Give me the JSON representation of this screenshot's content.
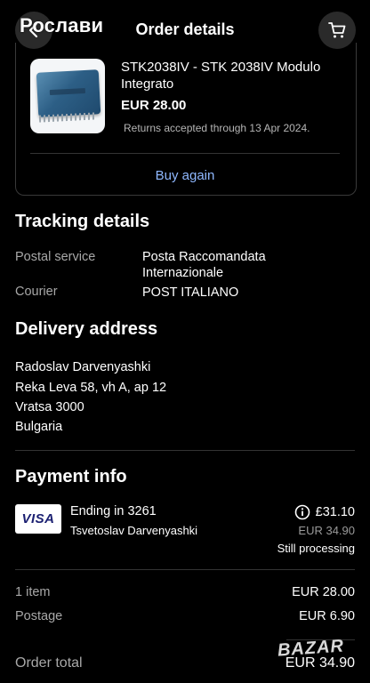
{
  "header": {
    "overlay_text": "Рослави",
    "title": "Order details",
    "back_icon": "chevron-left-icon",
    "cart_icon": "cart-icon"
  },
  "item": {
    "title": "STK2038IV - STK 2038IV Modulo Integrato",
    "price": "EUR 28.00",
    "returns": "Returns accepted through 13 Apr 2024.",
    "buy_again": "Buy again"
  },
  "tracking": {
    "heading": "Tracking details",
    "postal_service_label": "Postal service",
    "postal_service_value": "Posta Raccomandata Internazionale",
    "courier_label": "Courier",
    "courier_value": "POST ITALIANO"
  },
  "delivery": {
    "heading": "Delivery address",
    "lines": [
      "Radoslav Darvenyashki",
      "Reka Leva 58, vh A, ap 12",
      "Vratsa 3000",
      "Bulgaria"
    ]
  },
  "payment": {
    "heading": "Payment info",
    "card_brand": "VISA",
    "card_ending": "Ending in 3261",
    "card_holder": "Tsvetoslav Darvenyashki",
    "amount_gbp": "£31.10",
    "amount_eur": "EUR 34.90",
    "status": "Still processing"
  },
  "summary": {
    "items_label": "1 item",
    "items_value": "EUR 28.00",
    "postage_label": "Postage",
    "postage_value": "EUR 6.90",
    "total_label": "Order total",
    "total_value": "EUR 34.90"
  },
  "watermark": "BAZAR",
  "colors": {
    "link": "#8fb8ff",
    "background": "#000000",
    "muted": "#a8a8a8"
  }
}
